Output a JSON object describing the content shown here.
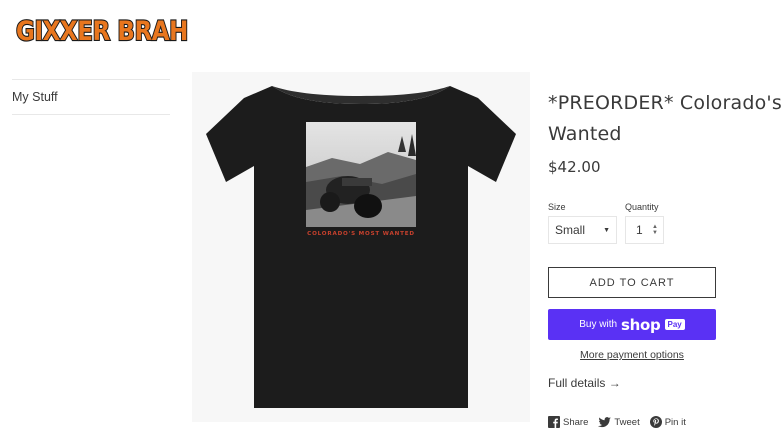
{
  "logo": {
    "text": "GIXXER BRAH",
    "fill": "#e8761e",
    "outline": "#1a1a1a"
  },
  "sidebar": {
    "items": [
      {
        "label": "My Stuff"
      }
    ]
  },
  "product": {
    "title_line1": "*PREORDER* Colorado's",
    "title_line2": "Wanted",
    "price": "$42.00",
    "shirt_print_caption": "COLORADO'S MOST WANTED",
    "shirt_color": "#1c1c1c",
    "caption_color": "#c8412d"
  },
  "options": {
    "size_label": "Size",
    "size_value": "Small",
    "quantity_label": "Quantity",
    "quantity_value": "1"
  },
  "actions": {
    "add_to_cart": "ADD TO CART",
    "buy_with": "Buy with",
    "shop": "shop",
    "pay": "Pay",
    "more_payment": "More payment options",
    "full_details": "Full details →"
  },
  "share": {
    "share": "Share",
    "tweet": "Tweet",
    "pin": "Pin it"
  },
  "colors": {
    "shop_pay": "#5a31f4"
  }
}
